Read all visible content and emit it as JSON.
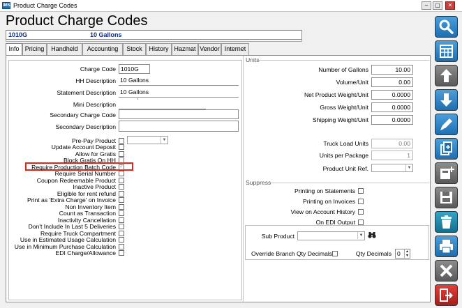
{
  "window": {
    "title": "Product Charge Codes",
    "app_icon": "IMS"
  },
  "header": {
    "title": "Product Charge Codes",
    "code": "1010G",
    "description": "10 Gallons"
  },
  "tabs": [
    {
      "label": "Info",
      "active": true
    },
    {
      "label": "Pricing"
    },
    {
      "label": "Handheld"
    },
    {
      "label": "Accounting"
    },
    {
      "label": "Stock"
    },
    {
      "label": "History"
    },
    {
      "label": "Hazmat"
    },
    {
      "label": "Vendor"
    },
    {
      "label": "Internet"
    }
  ],
  "info": {
    "charge_code_label": "Charge Code",
    "charge_code": "1010G",
    "hh_description_label": "HH Description",
    "hh_description": "10 Gallons",
    "statement_description_label": "Statement Description",
    "statement_description": "10 Gallons",
    "mini_description_label": "Mini Description",
    "mini_description": "",
    "secondary_charge_code_label": "Secondary Charge Code",
    "secondary_charge_code": "",
    "secondary_description_label": "Secondary Description",
    "secondary_description": "",
    "prepay_label": "Pre-Pay Product",
    "flags": [
      {
        "label": "Update Account Deposit",
        "checked": false
      },
      {
        "label": "Allow for Gratis",
        "checked": false
      },
      {
        "label": "Block Gratis On HH",
        "checked": false
      },
      {
        "label": "Require Production Batch Code",
        "checked": true
      },
      {
        "label": "Require Serial Number",
        "checked": false
      },
      {
        "label": "Coupon Redeemable Product",
        "checked": false
      },
      {
        "label": "Inactive Product",
        "checked": false
      },
      {
        "label": "Eligible for rent refund",
        "checked": false
      },
      {
        "label": "Print as 'Extra Charge' on Invoice",
        "checked": false
      },
      {
        "label": "Non Inventory Item",
        "checked": false
      },
      {
        "label": "Count as Transaction",
        "checked": false
      },
      {
        "label": "Inactivity Cancellation",
        "checked": false
      },
      {
        "label": "Don't Include In Last 5 Deliveries",
        "checked": false
      },
      {
        "label": "Require Truck Compartment",
        "checked": false
      },
      {
        "label": "Use in Estimated Usage Calculation",
        "checked": false
      },
      {
        "label": "Use in Minimum Purchase Calculation",
        "checked": false
      },
      {
        "label": "EDI Charge/Allowance",
        "checked": false
      }
    ]
  },
  "units": {
    "title": "Units",
    "rows": [
      {
        "label": "Number of Gallons",
        "value": "10.00"
      },
      {
        "label": "Volume/Unit",
        "value": "0.00"
      },
      {
        "label": "Net Product Weight/Unit",
        "value": "0.0000"
      },
      {
        "label": "Gross Weight/Unit",
        "value": "0.0000"
      },
      {
        "label": "Shipping Weight/Unit",
        "value": "0.0000"
      }
    ],
    "truck_load_units_label": "Truck Load Units",
    "truck_load_units": "0.00",
    "units_per_package_label": "Units per Package",
    "units_per_package": "1",
    "product_unit_ref_label": "Product Unit Ref."
  },
  "suppress": {
    "title": "Suppress",
    "items": [
      {
        "label": "Printing on Statements",
        "checked": false
      },
      {
        "label": "Printing on Invoices",
        "checked": false
      },
      {
        "label": "View on Account History",
        "checked": false
      },
      {
        "label": "On EDI Output",
        "checked": false
      }
    ]
  },
  "sub_product": {
    "label": "Sub Product",
    "override_label": "Override Branch Qty Decimals",
    "qty_decimals_label": "Qty Decimals",
    "qty_decimals": "0"
  },
  "sidebar": [
    {
      "name": "search-icon",
      "color": "blue"
    },
    {
      "name": "grid-icon",
      "color": "blue"
    },
    {
      "name": "arrow-up-icon",
      "color": "gray"
    },
    {
      "name": "arrow-down-icon",
      "color": "blue"
    },
    {
      "name": "pencil-icon",
      "color": "blue"
    },
    {
      "name": "copy-icon",
      "color": "blue"
    },
    {
      "name": "add-record-icon",
      "color": "gray"
    },
    {
      "name": "save-icon",
      "color": "gray"
    },
    {
      "name": "trash-icon",
      "color": "teal"
    },
    {
      "name": "print-icon",
      "color": "blue"
    },
    {
      "name": "cancel-icon",
      "color": "gray"
    },
    {
      "name": "exit-icon",
      "color": "red"
    }
  ]
}
